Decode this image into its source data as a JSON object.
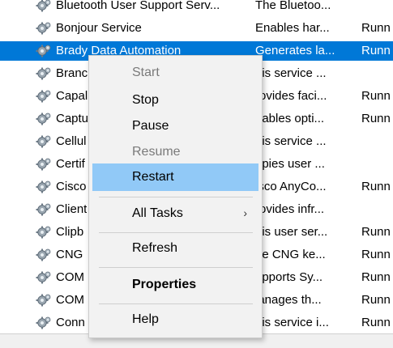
{
  "services": [
    {
      "name": "Bluetooth User Support Serv...",
      "description": "The Bluetoo...",
      "status": ""
    },
    {
      "name": "Bonjour Service",
      "description": "Enables har...",
      "status": "Runn"
    },
    {
      "name": "Brady Data Automation",
      "description": "Generates la...",
      "status": "Runn",
      "selected": true
    },
    {
      "name": "Branc",
      "description": "his service ...",
      "status": ""
    },
    {
      "name": "Capal",
      "description": "rovides faci...",
      "status": "Runn"
    },
    {
      "name": "Captu",
      "description": "nables opti...",
      "status": "Runn"
    },
    {
      "name": "Cellul",
      "description": "his service ...",
      "status": ""
    },
    {
      "name": "Certif",
      "description": "opies user ...",
      "status": ""
    },
    {
      "name": "Cisco",
      "description": "isco AnyCo...",
      "status": "Runn"
    },
    {
      "name": "Client",
      "description": "rovides infr...",
      "status": ""
    },
    {
      "name": "Clipb",
      "description": "his user ser...",
      "status": "Runn"
    },
    {
      "name": "CNG",
      "description": "he CNG ke...",
      "status": "Runn"
    },
    {
      "name": "COM",
      "description": "upports Sy...",
      "status": "Runn"
    },
    {
      "name": "COM",
      "description": "lanages th...",
      "status": "Runn"
    },
    {
      "name": "Conn",
      "description": "his service i...",
      "status": "Runn"
    }
  ],
  "context_menu": {
    "start": "Start",
    "stop": "Stop",
    "pause": "Pause",
    "resume": "Resume",
    "restart": "Restart",
    "all_tasks": "All Tasks",
    "all_tasks_arrow": "›",
    "refresh": "Refresh",
    "properties": "Properties",
    "help": "Help"
  },
  "colors": {
    "selection": "#0078d7",
    "menu_hover": "#91c9f7",
    "menu_bg": "#f2f2f2"
  },
  "icon": "gear-icon"
}
